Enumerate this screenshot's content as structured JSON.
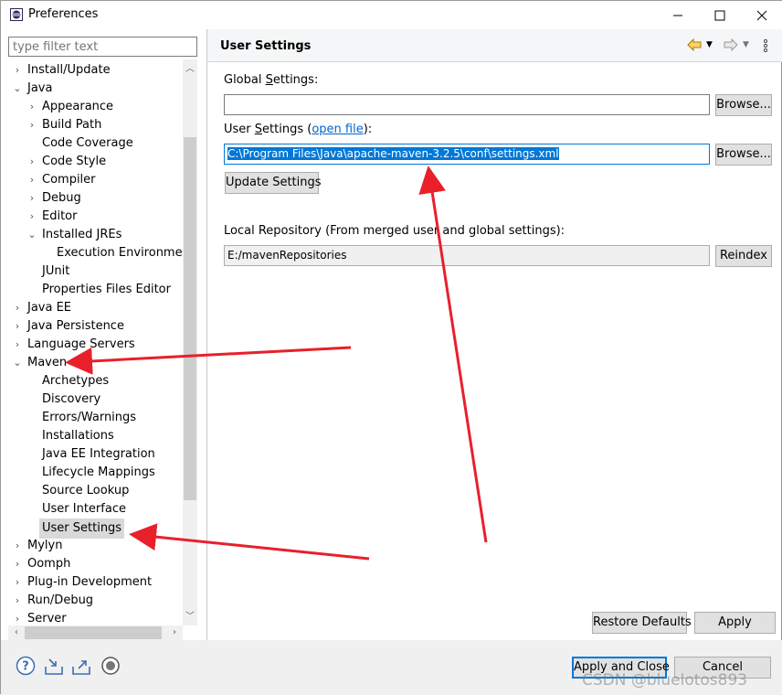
{
  "window": {
    "title": "Preferences"
  },
  "filter": {
    "placeholder": "type filter text"
  },
  "tree": [
    {
      "label": "Install/Update",
      "chevron": "›"
    },
    {
      "label": "Java",
      "chevron": "⌄"
    },
    {
      "label": "Appearance",
      "chevron": "›"
    },
    {
      "label": "Build Path",
      "chevron": "›"
    },
    {
      "label": "Code Coverage",
      "chevron": ""
    },
    {
      "label": "Code Style",
      "chevron": "›"
    },
    {
      "label": "Compiler",
      "chevron": "›"
    },
    {
      "label": "Debug",
      "chevron": "›"
    },
    {
      "label": "Editor",
      "chevron": "›"
    },
    {
      "label": "Installed JREs",
      "chevron": "⌄"
    },
    {
      "label": "Execution Environments",
      "chevron": ""
    },
    {
      "label": "JUnit",
      "chevron": ""
    },
    {
      "label": "Properties Files Editor",
      "chevron": ""
    },
    {
      "label": "Java EE",
      "chevron": "›"
    },
    {
      "label": "Java Persistence",
      "chevron": "›"
    },
    {
      "label": "Language Servers",
      "chevron": "›"
    },
    {
      "label": "Maven",
      "chevron": "⌄"
    },
    {
      "label": "Archetypes",
      "chevron": ""
    },
    {
      "label": "Discovery",
      "chevron": ""
    },
    {
      "label": "Errors/Warnings",
      "chevron": ""
    },
    {
      "label": "Installations",
      "chevron": ""
    },
    {
      "label": "Java EE Integration",
      "chevron": ""
    },
    {
      "label": "Lifecycle Mappings",
      "chevron": ""
    },
    {
      "label": "Source Lookup",
      "chevron": ""
    },
    {
      "label": "User Interface",
      "chevron": ""
    },
    {
      "label": "User Settings",
      "chevron": "",
      "selected": true
    },
    {
      "label": "Mylyn",
      "chevron": "›"
    },
    {
      "label": "Oomph",
      "chevron": "›"
    },
    {
      "label": "Plug-in Development",
      "chevron": "›"
    },
    {
      "label": "Run/Debug",
      "chevron": "›"
    },
    {
      "label": "Server",
      "chevron": "›"
    }
  ],
  "page": {
    "title": "User Settings",
    "global_settings": {
      "label_pre": "Global ",
      "label_mnemonic": "S",
      "label_post": "ettings:",
      "value": "",
      "browse": "Browse..."
    },
    "user_settings": {
      "label_pre": "User ",
      "label_mnemonic": "S",
      "label_post": "ettings (",
      "link": "open file",
      "label_end": "):",
      "value": "C:\\Program Files\\Java\\apache-maven-3.2.5\\conf\\settings.xml",
      "browse": "Browse..."
    },
    "update_settings": "Update Settings",
    "local_repo": {
      "label": "Local Repository (From merged user and global settings):",
      "value": "E:/mavenRepositories",
      "reindex": "Reindex"
    },
    "restore_defaults": "Restore Defaults",
    "apply": "Apply"
  },
  "footer": {
    "apply_close": "Apply and Close",
    "cancel": "Cancel",
    "watermark": "CSDN @bluelotos893"
  },
  "colors": {
    "selection": "#0078d7",
    "annotation_arrow": "#e8202a"
  }
}
